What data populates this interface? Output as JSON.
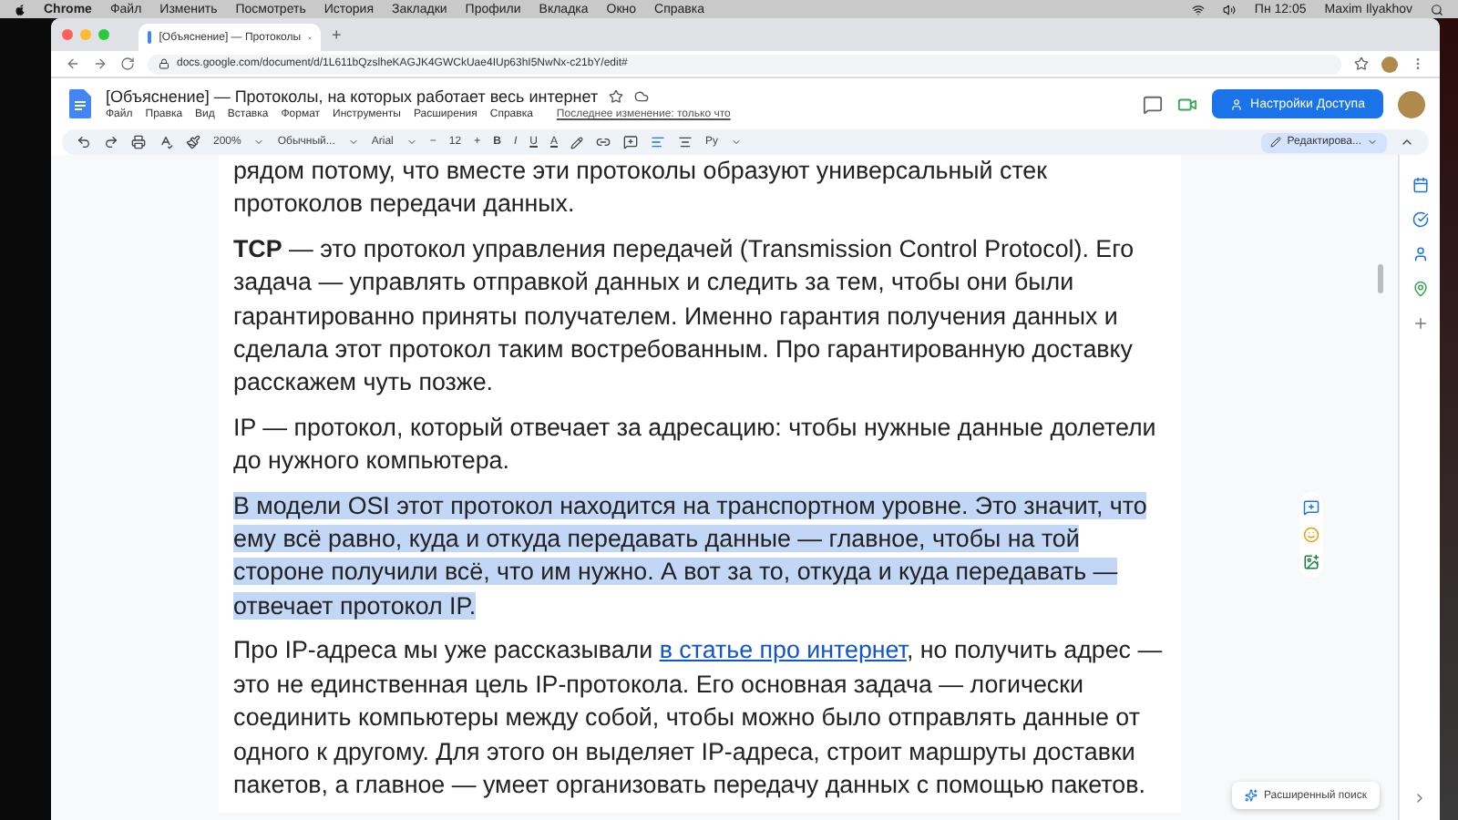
{
  "menu_bar": {
    "app": "Chrome",
    "items": [
      "Файл",
      "Изменить",
      "Посмотреть",
      "История",
      "Закладки",
      "Профили",
      "Вкладка",
      "Окно",
      "Справка"
    ],
    "clock": "Пн 12:05",
    "user": "Maxim Ilyakhov"
  },
  "browser": {
    "tab_title": "[Объяснение] — Протоколы",
    "new_tab": "+",
    "url": "docs.google.com/document/d/1L611bQzslheKAGJK4GWCkUae4IUp63hI5NwNx-c21bY/edit#"
  },
  "docs": {
    "title": "[Объяснение] — Протоколы, на которых работает весь интернет",
    "menu": [
      "Файл",
      "Правка",
      "Вид",
      "Вставка",
      "Формат",
      "Инструменты",
      "Расширения",
      "Справка"
    ],
    "last_edit": "Последнее изменение: только что",
    "share": "Настройки Доступа",
    "toolbar": {
      "zoom": "200%",
      "style": "Обычный...",
      "font": "Arial",
      "minus": "−",
      "font_size": "12",
      "plus": "+",
      "bold": "B",
      "italic": "I",
      "underline": "U",
      "text_color": "A",
      "lang": "Ру",
      "mode": "Редактирова..."
    },
    "paragraphs": [
      {
        "kind": "text",
        "selected": false,
        "text": "рядом потому, что вместе эти протоколы образуют универсальный стек протоколов передачи данных."
      },
      {
        "kind": "text",
        "selected": false,
        "text": "**TCP** — это протокол управления передачей (Transmission Control Protocol). Его задача — управлять отправкой данных и следить за тем, чтобы они были гарантированно приняты получателем. Именно гарантия получения данных и сделала этот протокол таким востребованным. Про гарантированную доставку расскажем чуть позже."
      },
      {
        "kind": "text",
        "selected": false,
        "text": "IP — протокол, который отвечает за адресацию: чтобы нужные данные долетели до нужного компьютера."
      },
      {
        "kind": "text",
        "selected": true,
        "text": "В модели OSI этот протокол находится на транспортном уровне. Это значит, что ему всё равно, куда и откуда передавать данные — главное, чтобы на той стороне получили всё, что им нужно. А вот за то, откуда и куда передавать — отвечает протокол IP."
      },
      {
        "kind": "link",
        "selected": false,
        "before": "Про IP-адреса мы уже рассказывали",
        "link": "в статье про интернет",
        "text": ", но получить адрес — это не единственная цель IP-протокола. Его основная задача — логически соединить компьютеры между собой, чтобы можно было отправлять данные от одного к другому. Для этого он выделяет IP-адреса, строит маршруты доставки пакетов, а главное — умеет организовать передачу данных с помощью пакетов."
      }
    ],
    "explore": "Расширенный поиск"
  }
}
